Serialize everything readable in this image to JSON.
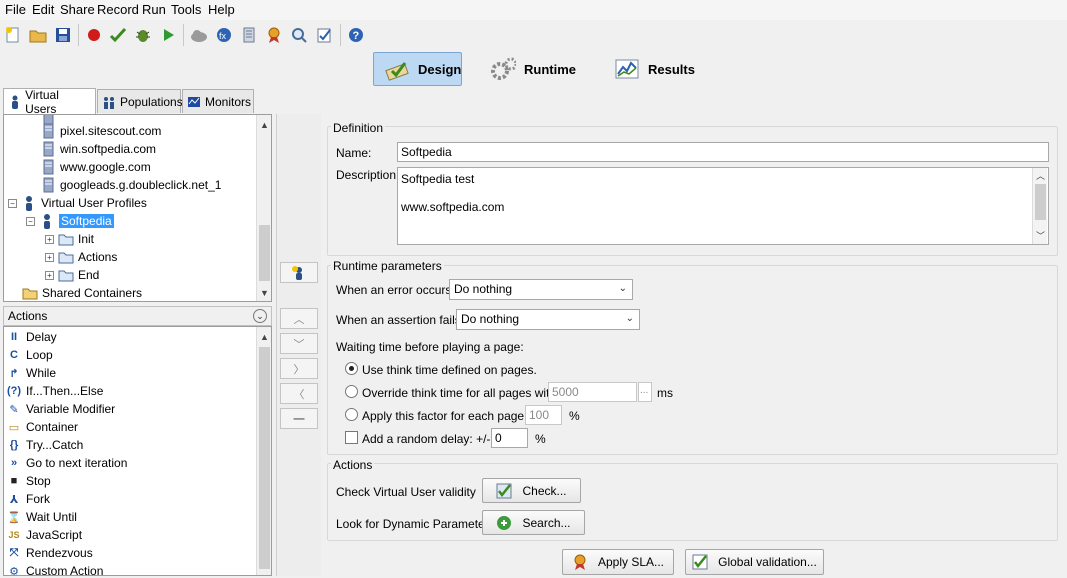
{
  "menu": [
    "File",
    "Edit",
    "Share",
    "Record",
    "Run",
    "Tools",
    "Help"
  ],
  "toolbar": {
    "icons": [
      "new-project-icon",
      "open-project-icon",
      "save-icon",
      "record-icon",
      "check-icon",
      "debug-icon",
      "play-icon",
      "cloud-icon",
      "formula-icon",
      "database-icon",
      "sla-icon",
      "search-icon",
      "validate-icon",
      "help-icon"
    ]
  },
  "modes": [
    {
      "label": "Design",
      "icon": "design-icon",
      "active": true
    },
    {
      "label": "Runtime",
      "icon": "gears-icon",
      "active": false
    },
    {
      "label": "Results",
      "icon": "results-chart-icon",
      "active": false
    }
  ],
  "left_tabs": [
    {
      "label": "Virtual Users",
      "icon": "virtual-user-icon",
      "selected": true
    },
    {
      "label": "Populations",
      "icon": "population-icon",
      "selected": false
    },
    {
      "label": "Monitors",
      "icon": "monitor-icon",
      "selected": false
    }
  ],
  "tree": {
    "servers": [
      "pixel.sitescout.com",
      "win.softpedia.com",
      "www.google.com",
      "googleads.g.doubleclick.net_1"
    ],
    "profiles_label": "Virtual User Profiles",
    "selected_profile": "Softpedia",
    "containers": [
      "Init",
      "Actions",
      "End"
    ],
    "shared_label": "Shared Containers"
  },
  "actions": {
    "header": "Actions",
    "items": [
      "Delay",
      "Loop",
      "While",
      "If...Then...Else",
      "Variable Modifier",
      "Container",
      "Try...Catch",
      "Go to next iteration",
      "Stop",
      "Fork",
      "Wait Until",
      "JavaScript",
      "Rendezvous",
      "Custom Action"
    ],
    "glyphs": [
      "II",
      "C",
      "↱",
      "(?)",
      "✎",
      "▭",
      "{}",
      "»",
      "■",
      "⅄",
      "⌛",
      "JS",
      "⤧",
      "⚙"
    ]
  },
  "definition": {
    "title": "Definition",
    "name_label": "Name:",
    "name_value": "Softpedia",
    "desc_label": "Description:",
    "desc_line1": "Softpedia test",
    "desc_line2": "www.softpedia.com"
  },
  "runtime": {
    "title": "Runtime parameters",
    "error_label": "When an error occurs:",
    "error_value": "Do nothing",
    "assert_label": "When an assertion fails:",
    "assert_value": "Do nothing",
    "wait_label": "Waiting time before playing a page:",
    "opt1": "Use think time defined on pages.",
    "opt2": "Override think time for all pages with:",
    "opt2_value": "5000",
    "opt2_unit": "ms",
    "opt2_more": "...",
    "opt3": "Apply this factor for each page:",
    "opt3_value": "100",
    "opt3_unit": "%",
    "opt4": "Add a random delay: +/-",
    "opt4_value": "0",
    "opt4_unit": "%"
  },
  "actions_group": {
    "title": "Actions",
    "check_label": "Check Virtual User validity",
    "check_button": "Check...",
    "search_label": "Look for Dynamic Parameters",
    "search_button": "Search..."
  },
  "bottom": {
    "apply_sla": "Apply SLA...",
    "global_validation": "Global validation..."
  }
}
